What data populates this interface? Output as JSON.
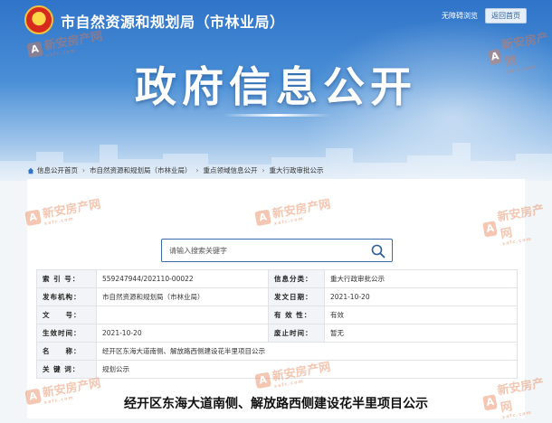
{
  "header": {
    "site_title": "市自然资源和规划局（市林业局）",
    "accessibility_link": "无障碍浏览",
    "home_button": "返回首页",
    "banner_title": "政府信息公开"
  },
  "breadcrumb": [
    "信息公开首页",
    "市自然资源和规划局（市林业局）",
    "重点领域信息公开",
    "重大行政审批公示"
  ],
  "search": {
    "placeholder": "请输入搜索关键字"
  },
  "meta_rows": [
    {
      "k1": "索 引 号：",
      "v1": "559247944/202110-00022",
      "k2": "信息分类：",
      "v2": "重大行政审批公示"
    },
    {
      "k1": "发布机构：",
      "v1": "市自然资源和规划局（市林业局）",
      "k2": "发文日期：",
      "v2": "2021-10-20"
    },
    {
      "k1": "文　　号：",
      "v1": "",
      "k2": "有 效 性：",
      "v2": "有效"
    },
    {
      "k1": "生效时间：",
      "v1": "2021-10-20",
      "k2": "废止时间：",
      "v2": "暂无"
    },
    {
      "k1": "名　　称：",
      "v1": "经开区东海大道南侧、解放路西侧建设花半里项目公示"
    },
    {
      "k1": "关 键 词：",
      "v1": "规划公示"
    }
  ],
  "document_title": "经开区东海大道南侧、解放路西侧建设花半里项目公示",
  "watermark": {
    "text": "新安房产网",
    "sub": "xafc.com",
    "logo": "A"
  },
  "colors": {
    "banner": "#2f74c9",
    "accent": "#3b6aa8"
  }
}
